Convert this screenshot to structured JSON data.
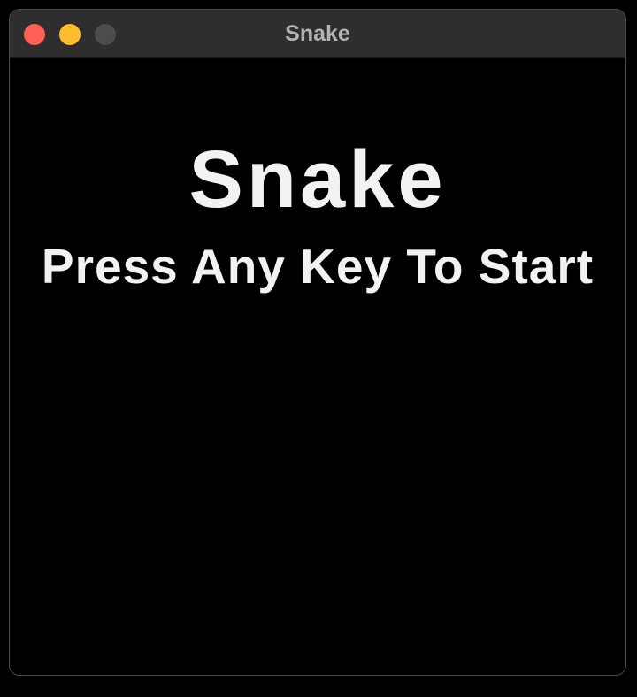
{
  "window": {
    "title": "Snake",
    "controls": [
      {
        "name": "close",
        "color": "#fe5f57"
      },
      {
        "name": "minimize",
        "color": "#febc2e"
      },
      {
        "name": "zoom",
        "color": "#4c4c4c"
      }
    ]
  },
  "game": {
    "title": "Snake",
    "prompt": "Press Any Key To Start",
    "background_color": "#000000",
    "text_color": "#f2f2f2"
  }
}
